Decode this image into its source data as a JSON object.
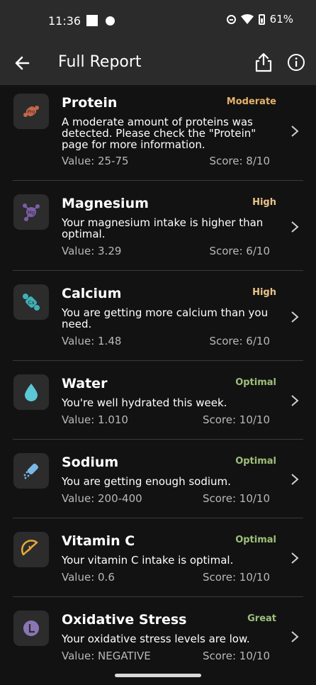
{
  "status_bar": {
    "time": "11:36",
    "battery": "61%"
  },
  "appbar": {
    "title": "Full Report"
  },
  "colors": {
    "moderate": "#e6b26b",
    "high": "#ebc48a",
    "optimal": "#9ec07a",
    "great": "#9ec07a"
  },
  "items": [
    {
      "name": "Protein",
      "status": "Moderate",
      "desc": "A moderate amount of proteins was detected. Please check the \"Protein\" page for more information.",
      "value": "Value: 25-75",
      "score": "Score: 8/10",
      "icon": "protein-icon"
    },
    {
      "name": "Magnesium",
      "status": "High",
      "desc": "Your magnesium intake is higher than optimal.",
      "value": "Value: 3.29",
      "score": "Score: 6/10",
      "icon": "magnesium-icon"
    },
    {
      "name": "Calcium",
      "status": "High",
      "desc": "You are getting more calcium than you need.",
      "value": "Value: 1.48",
      "score": "Score: 6/10",
      "icon": "calcium-icon"
    },
    {
      "name": "Water",
      "status": "Optimal",
      "desc": "You're well hydrated this week.",
      "value": "Value: 1.010",
      "score": "Score: 10/10",
      "icon": "water-drop-icon"
    },
    {
      "name": "Sodium",
      "status": "Optimal",
      "desc": "You are getting enough sodium.",
      "value": "Value: 200-400",
      "score": "Score: 10/10",
      "icon": "salt-shaker-icon"
    },
    {
      "name": "Vitamin C",
      "status": "Optimal",
      "desc": "Your vitamin C intake is optimal.",
      "value": "Value: 0.6",
      "score": "Score: 10/10",
      "icon": "orange-slice-icon"
    },
    {
      "name": "Oxidative Stress",
      "status": "Great",
      "desc": "Your oxidative stress levels are low.",
      "value": "Value: NEGATIVE",
      "score": "Score: 10/10",
      "icon": "oxidative-stress-icon"
    }
  ]
}
